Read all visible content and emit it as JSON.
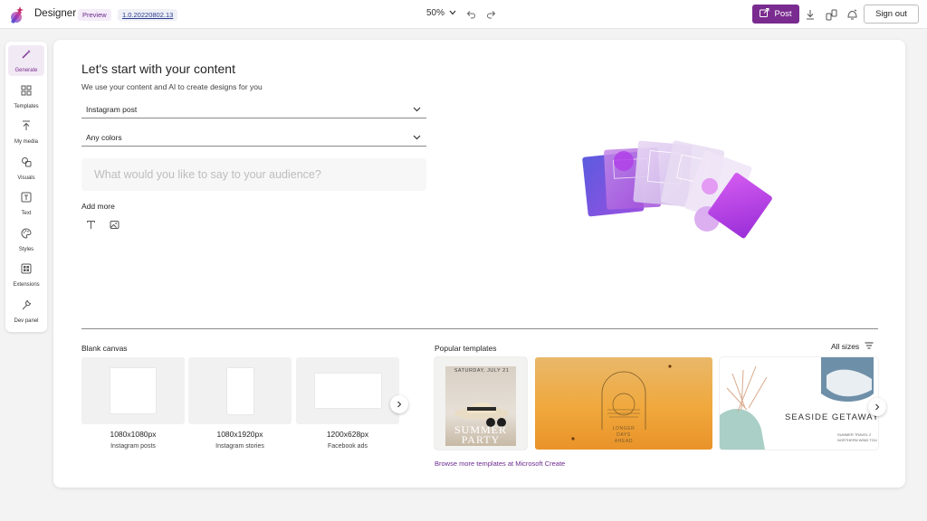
{
  "header": {
    "app_title": "Designer",
    "badge": "Preview",
    "version": "1.0.20220802.13",
    "zoom": "50%",
    "post_label": "Post",
    "signout_label": "Sign out"
  },
  "rail": {
    "items": [
      {
        "label": "Generate",
        "icon": "wand-icon"
      },
      {
        "label": "Templates",
        "icon": "grid-icon"
      },
      {
        "label": "My media",
        "icon": "upload-icon"
      },
      {
        "label": "Visuals",
        "icon": "shapes-icon"
      },
      {
        "label": "Text",
        "icon": "text-icon"
      },
      {
        "label": "Styles",
        "icon": "palette-icon"
      },
      {
        "label": "Extensions",
        "icon": "apps-icon"
      },
      {
        "label": "Dev panel",
        "icon": "wrench-icon"
      }
    ]
  },
  "main": {
    "heading": "Let's start with your content",
    "subheading": "We use your content and AI to create designs for you",
    "format_select": "Instagram post",
    "colors_select": "Any colors",
    "prompt_placeholder": "What would you like to say to your audience?",
    "add_more": "Add more"
  },
  "blank_canvas": {
    "title": "Blank canvas",
    "items": [
      {
        "size": "1080x1080px",
        "desc": "Instagram posts"
      },
      {
        "size": "1080x1920px",
        "desc": "Instagram stories"
      },
      {
        "size": "1200x628px",
        "desc": "Facebook ads"
      }
    ]
  },
  "templates": {
    "title": "Popular templates",
    "all_sizes": "All sizes",
    "browse": "Browse more templates at Microsoft Create",
    "t1": {
      "date": "SATURDAY, JULY 21",
      "line1": "SUMMER",
      "line2": "PARTY"
    },
    "t2": {
      "line1": "LONGER",
      "line2": "DAYS",
      "line3": "AHEAD"
    },
    "t3": {
      "title": "SEASIDE GETAWAY",
      "sub1": "SUMMER TRAVEL 2",
      "sub2": "NORTHERN WIND TOU"
    }
  },
  "colors": {
    "accent": "#7a2b8f"
  }
}
